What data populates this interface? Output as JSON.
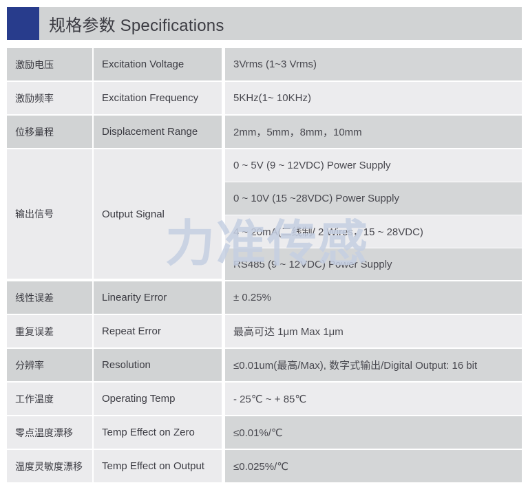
{
  "header": {
    "title": "规格参数 Specifications",
    "accent_color": "#283c8c",
    "bar_color": "#d1d3d4"
  },
  "watermark": {
    "text": "力准传感",
    "color": "#c5cfe2"
  },
  "colors": {
    "row_dark": "#d1d3d4",
    "row_light": "#ebebed",
    "text": "#3b3b42",
    "page_background": "#ffffff"
  },
  "table": {
    "rows": [
      {
        "zh": "激励电压",
        "en": "Excitation Voltage",
        "value": "3Vrms (1~3 Vrms)"
      },
      {
        "zh": "激励频率",
        "en": "Excitation Frequency",
        "value": "5KHz(1~ 10KHz)"
      },
      {
        "zh": "位移量程",
        "en": "Displacement Range",
        "value": "2mm，5mm，8mm，10mm"
      },
      {
        "zh": "输出信号",
        "en": "Output Signal",
        "values": [
          "0 ~ 5V (9 ~ 12VDC) Power Supply",
          "0 ~ 10V (15 ~28VDC) Power Supply",
          "4 ~ 20mA(二线制/ 2 Wires，15 ~ 28VDC)",
          "RS485 (9 ~ 12VDC) Power Supply"
        ]
      },
      {
        "zh": "线性误差",
        "en": "Linearity Error",
        "value": "± 0.25%"
      },
      {
        "zh": "重复误差",
        "en": "Repeat Error",
        "value": "最高可达 1μm  Max 1μm"
      },
      {
        "zh": "分辨率",
        "en": "Resolution",
        "value": "≤0.01um(最高/Max), 数字式输出/Digital Output: 16 bit"
      },
      {
        "zh": "工作温度",
        "en": "Operating Temp",
        "value": "- 25℃ ~ + 85℃"
      },
      {
        "zh": "零点温度漂移",
        "en": "Temp Effect on Zero",
        "value": "≤0.01%/℃"
      },
      {
        "zh": "温度灵敏度漂移",
        "en": "Temp Effect on Output",
        "value": "≤0.025%/℃"
      }
    ]
  }
}
